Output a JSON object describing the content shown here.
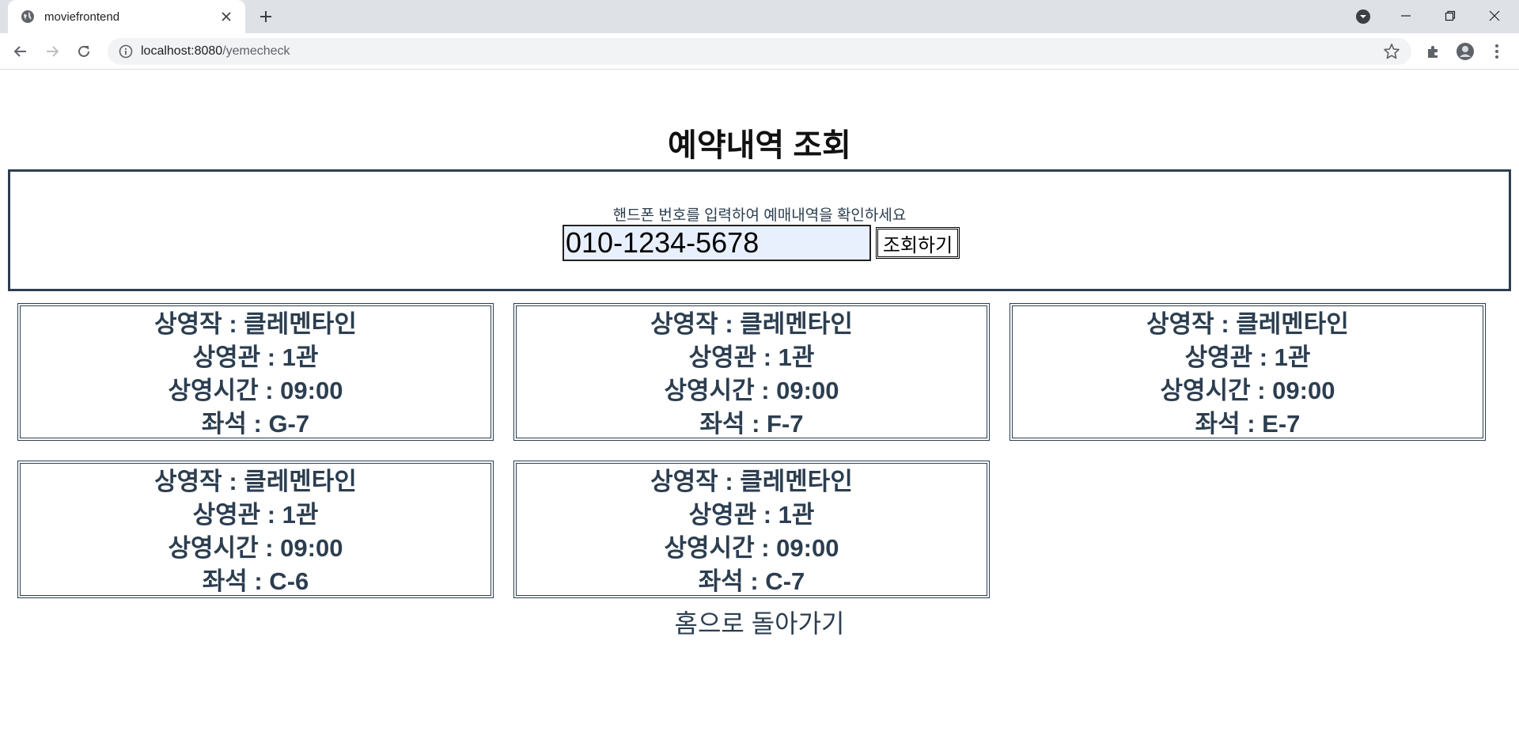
{
  "browser": {
    "tab_title": "moviefrontend",
    "url_host": "localhost:8080",
    "url_path": "/yemecheck"
  },
  "page": {
    "title": "예약내역 조회",
    "search": {
      "hint": "핸드폰 번호를 입력하여 예매내역을 확인하세요",
      "phone_value": "010-1234-5678",
      "button_label": "조회하기"
    },
    "reservations": [
      {
        "movie": "상영작 : 클레멘타인",
        "hall": "상영관 : 1관",
        "time": "상영시간 : 09:00",
        "seat": "좌석 : G-7"
      },
      {
        "movie": "상영작 : 클레멘타인",
        "hall": "상영관 : 1관",
        "time": "상영시간 : 09:00",
        "seat": "좌석 : F-7"
      },
      {
        "movie": "상영작 : 클레멘타인",
        "hall": "상영관 : 1관",
        "time": "상영시간 : 09:00",
        "seat": "좌석 : E-7"
      },
      {
        "movie": "상영작 : 클레멘타인",
        "hall": "상영관 : 1관",
        "time": "상영시간 : 09:00",
        "seat": "좌석 : C-6"
      },
      {
        "movie": "상영작 : 클레멘타인",
        "hall": "상영관 : 1관",
        "time": "상영시간 : 09:00",
        "seat": "좌석 : C-7"
      }
    ],
    "home_link": "홈으로 돌아가기"
  }
}
